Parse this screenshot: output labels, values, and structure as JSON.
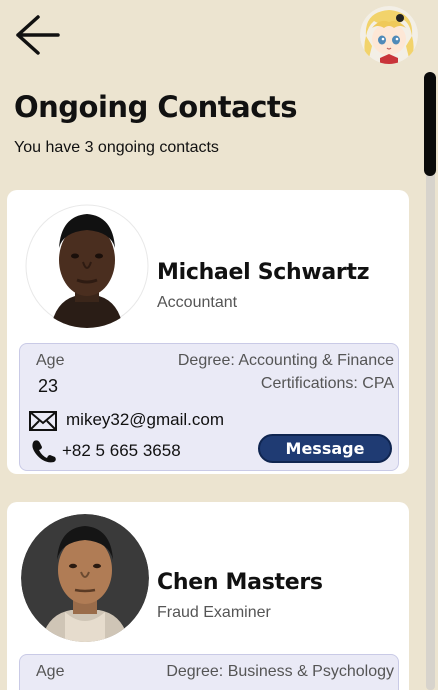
{
  "header": {
    "back_icon": "arrow-left-icon",
    "avatar": "user-avatar"
  },
  "page": {
    "title": "Ongoing Contacts",
    "subtitle": "You have 3 ongoing contacts"
  },
  "contacts": [
    {
      "name": "Michael Schwartz",
      "role": "Accountant",
      "age_label": "Age",
      "age": "23",
      "degree": "Degree: Accounting & Finance",
      "certifications": "Certifications: CPA",
      "email": "mikey32@gmail.com",
      "phone": "+82 5 665 3658",
      "message_label": "Message"
    },
    {
      "name": "Chen Masters",
      "role": "Fraud Examiner",
      "age_label": "Age",
      "degree": "Degree: Business & Psychology"
    }
  ],
  "colors": {
    "background": "#ece4d0",
    "card": "#ffffff",
    "info_panel": "#eaeaf6",
    "button": "#1f3b73"
  }
}
